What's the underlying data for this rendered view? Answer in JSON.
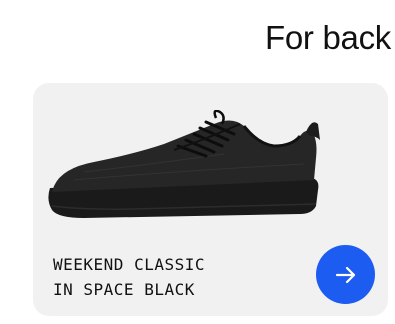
{
  "header": {
    "title": "For back"
  },
  "product": {
    "name_line1": "WEEKEND CLASSIC",
    "name_line2": "IN SPACE BLACK",
    "image_icon": "black-sneaker-image",
    "action_icon": "arrow-right-icon"
  },
  "colors": {
    "card_background": "#f1f1f1",
    "button": "#1d5cf0",
    "text": "#111111"
  }
}
